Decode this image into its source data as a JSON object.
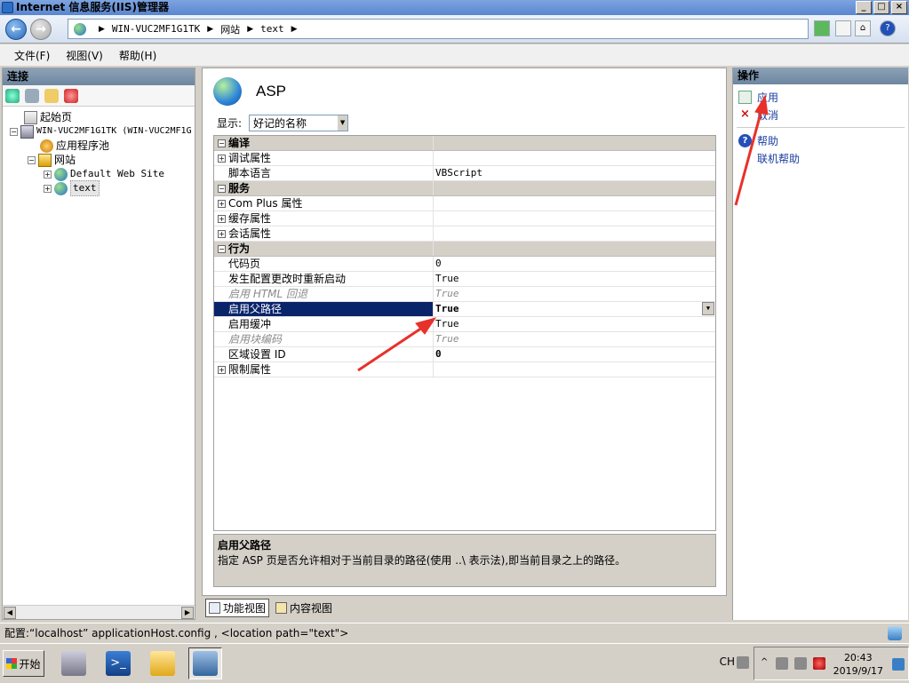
{
  "window": {
    "title": "Internet 信息服务(IIS)管理器"
  },
  "address": {
    "segments": [
      "WIN-VUC2MF1G1TK",
      "网站",
      "text"
    ]
  },
  "menu": {
    "items": [
      "文件(F)",
      "视图(V)",
      "帮助(H)"
    ]
  },
  "connections": {
    "title": "连接",
    "tree": {
      "start_page": "起始页",
      "server": "WIN-VUC2MF1G1TK (WIN-VUC2MF1G",
      "app_pools": "应用程序池",
      "sites": "网站",
      "default_site": "Default Web Site",
      "text_site": "text"
    }
  },
  "main": {
    "title": "ASP",
    "display_label": "显示:",
    "display_value": "好记的名称",
    "grid": {
      "cat_compile": "编译",
      "debug_props": "调试属性",
      "script_lang": "脚本语言",
      "script_lang_val": "VBScript",
      "cat_services": "服务",
      "complus_props": "Com Plus 属性",
      "cache_props": "缓存属性",
      "session_props": "会话属性",
      "cat_behavior": "行为",
      "code_page": "代码页",
      "code_page_val": "0",
      "restart_on_config": "发生配置更改时重新启动",
      "restart_on_config_val": "True",
      "html_fallback": "启用 HTML 回退",
      "html_fallback_val": "True",
      "parent_paths": "启用父路径",
      "parent_paths_val": "True",
      "buffering": "启用缓冲",
      "buffering_val": "True",
      "chunked": "启用块编码",
      "chunked_val": "True",
      "locale_id": "区域设置 ID",
      "locale_id_val": "0",
      "limits_props": "限制属性"
    },
    "description": {
      "title": "启用父路径",
      "text": "指定 ASP 页是否允许相对于当前目录的路径(使用 ..\\ 表示法),即当前目录之上的路径。"
    },
    "views": {
      "features": "功能视图",
      "content": "内容视图"
    }
  },
  "actions": {
    "title": "操作",
    "apply": "应用",
    "cancel": "取消",
    "help": "帮助",
    "online_help": "联机帮助"
  },
  "statusbar": {
    "text": "配置:“localhost” applicationHost.config , <location path=\"text\">"
  },
  "taskbar": {
    "start": "开始",
    "lang": "CH",
    "time": "20:43",
    "date": "2019/9/17"
  },
  "colors": {
    "selection": "#0a246a",
    "link": "#1a3fa0",
    "annotation_arrow": "#e8312a"
  }
}
